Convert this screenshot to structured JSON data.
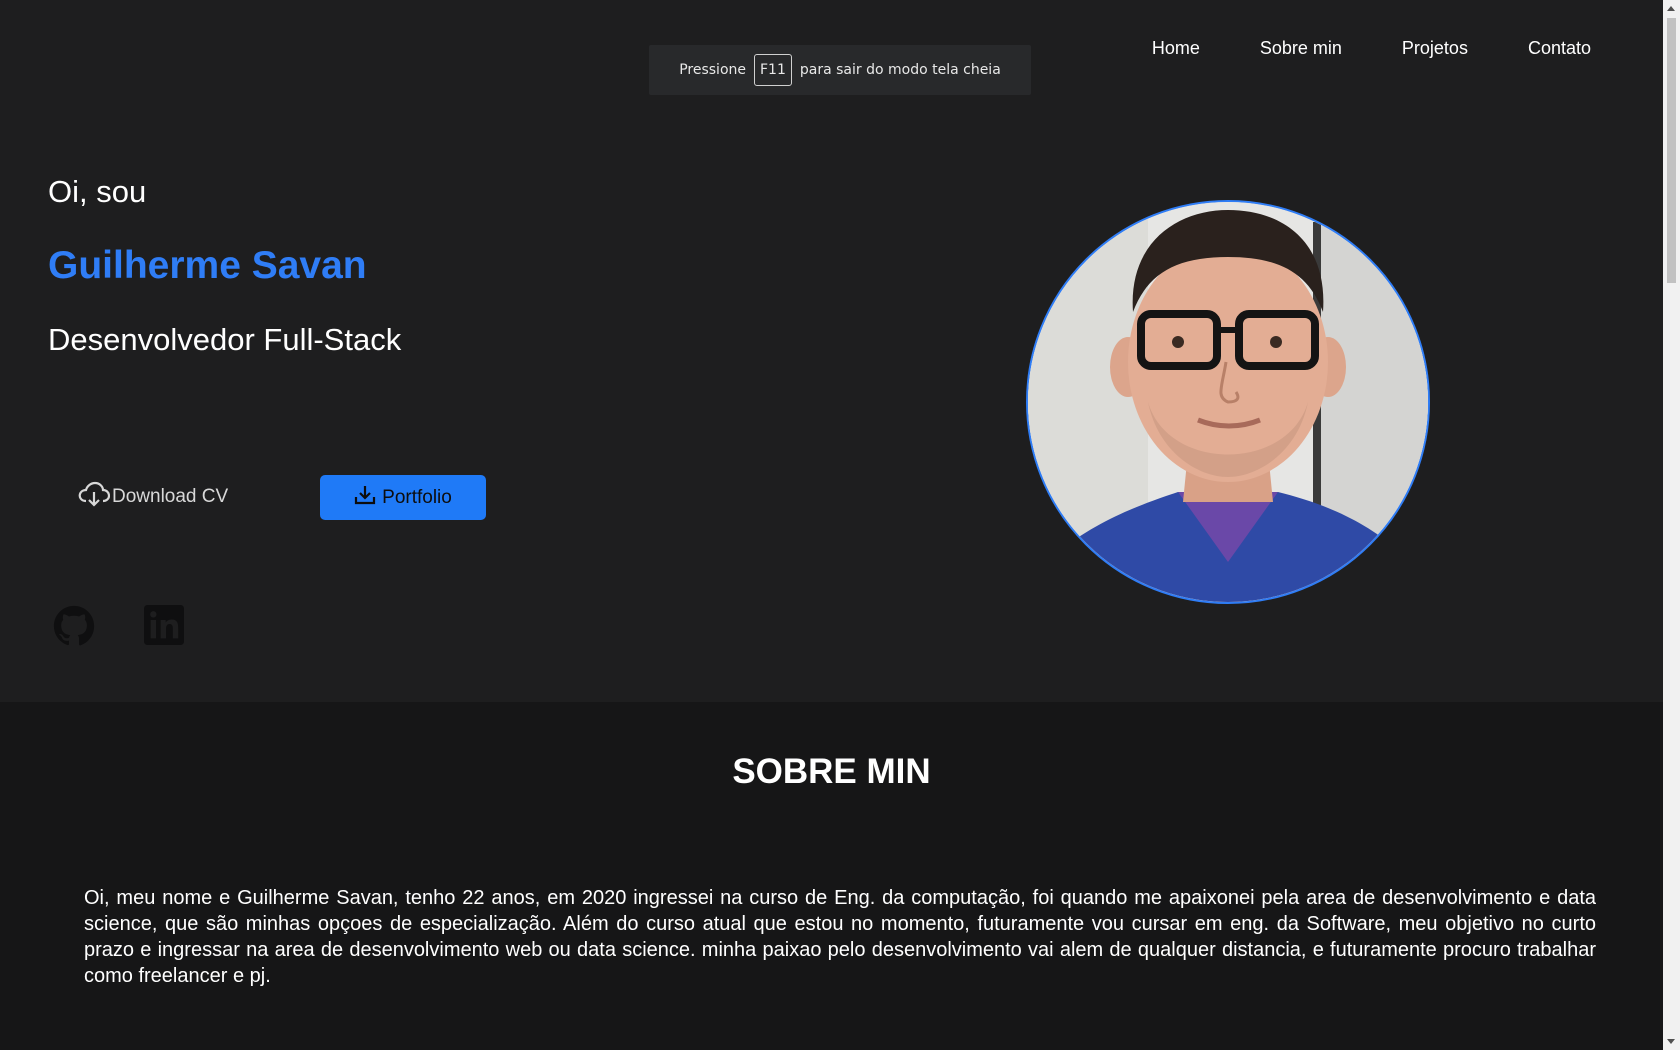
{
  "nav": {
    "items": [
      "Home",
      "Sobre min",
      "Projetos",
      "Contato"
    ]
  },
  "toast": {
    "prefix": "Pressione",
    "key": "F11",
    "suffix": "para sair do modo tela cheia"
  },
  "hero": {
    "greeting": "Oi, sou",
    "name": "Guilherme Savan",
    "role": "Desenvolvedor Full-Stack",
    "download_cv_label": "Download CV",
    "portfolio_label": "Portfolio",
    "icons": {
      "download_cv": "cloud-download-icon",
      "portfolio": "download-icon",
      "github": "github-icon",
      "linkedin": "linkedin-icon"
    }
  },
  "about": {
    "title": "SOBRE MIN",
    "text": "Oi, meu nome e Guilherme Savan, tenho 22 anos, em 2020 ingressei na curso de Eng. da computação, foi quando me apaixonei pela area de desenvolvimento e data science, que são minhas opçoes de especialização. Além do curso atual que estou no momento, futuramente vou cursar em eng. da Software, meu objetivo no curto prazo e ingressar na area de desenvolvimento web ou data science. minha paixao pelo desenvolvimento vai alem de qualquer distancia, e futuramente procuro trabalhar como freelancer e pj."
  },
  "colors": {
    "background": "#1e1e1f",
    "section_background": "#161617",
    "accent": "#2f7df6",
    "button": "#1f7af7"
  }
}
